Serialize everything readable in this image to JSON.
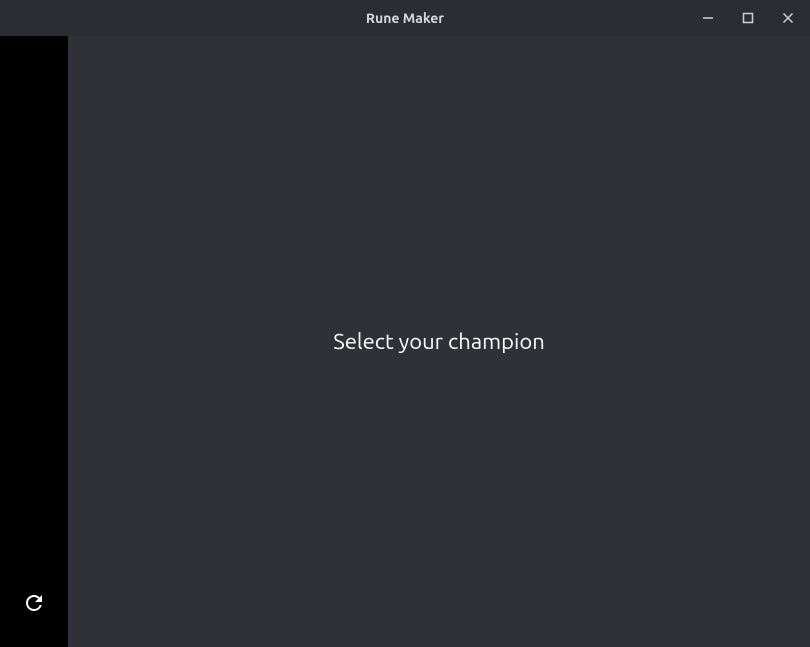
{
  "window": {
    "title": "Rune Maker"
  },
  "main": {
    "prompt": "Select your champion"
  },
  "icons": {
    "minimize": "minimize-icon",
    "maximize": "maximize-icon",
    "close": "close-icon",
    "refresh": "refresh-icon"
  }
}
